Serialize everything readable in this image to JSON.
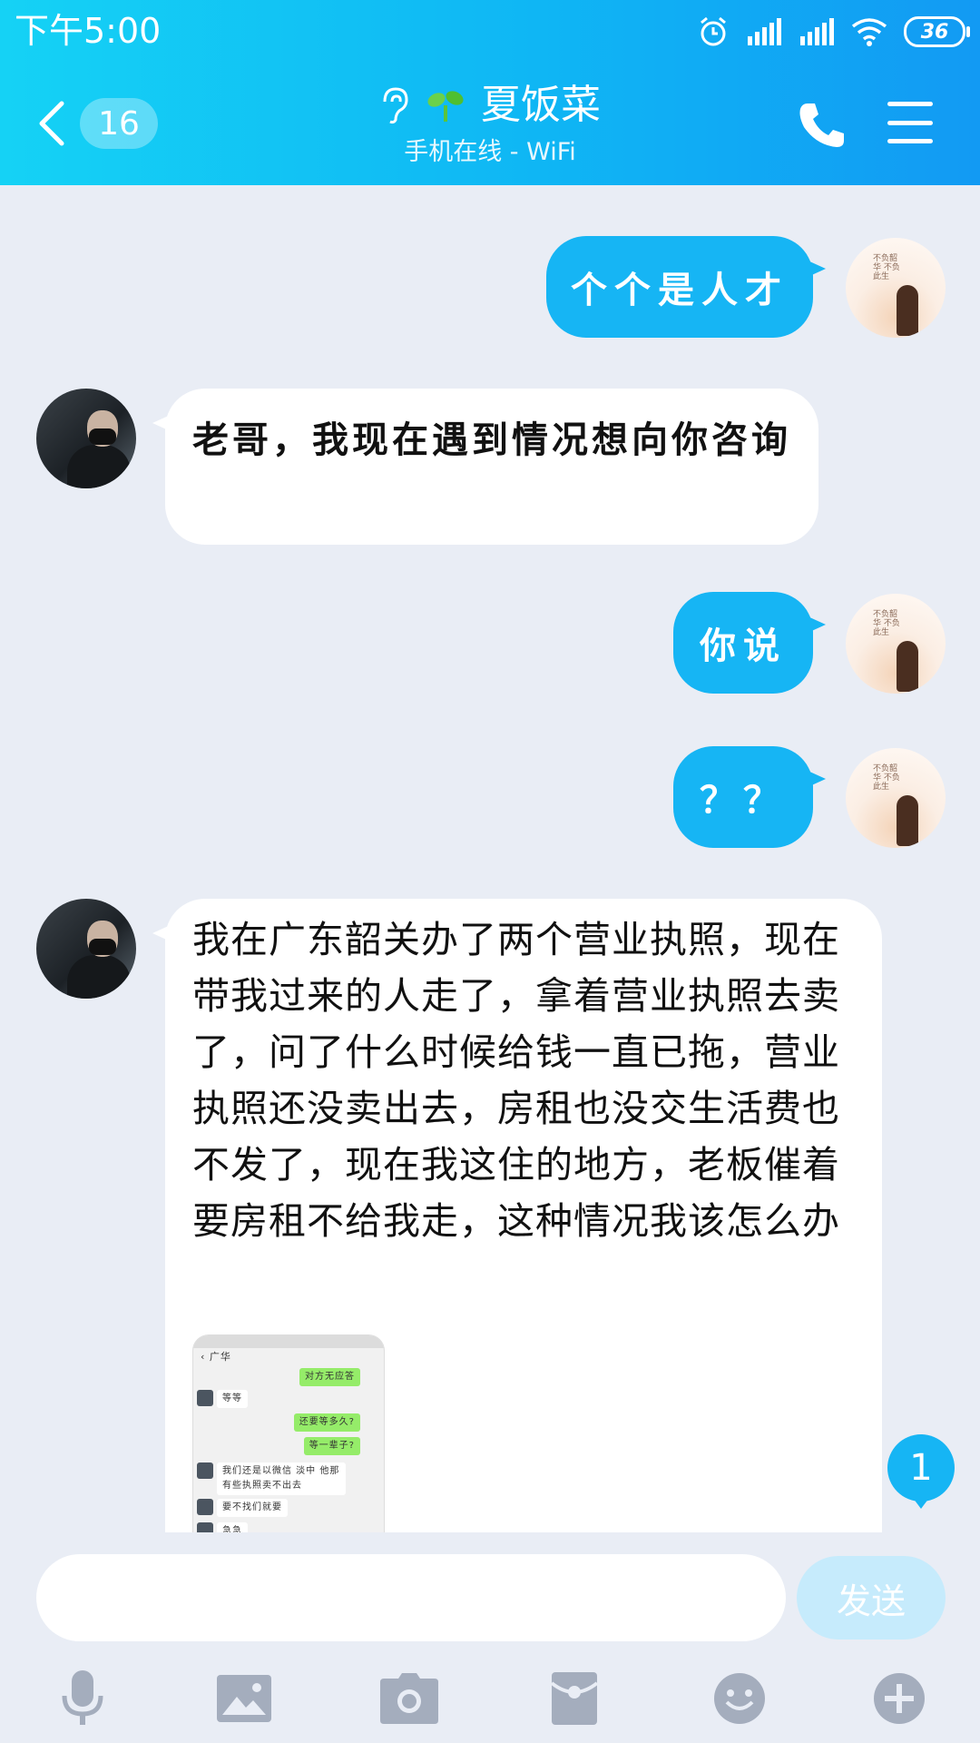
{
  "status_bar": {
    "time": "下午5:00",
    "battery": "36"
  },
  "header": {
    "back_count": "16",
    "contact_name": "夏饭菜",
    "presence": "手机在线 - WiFi"
  },
  "messages": [
    {
      "from": "me",
      "text": "个个是人才"
    },
    {
      "from": "other",
      "text": "老哥，我现在遇到情况想向你咨询"
    },
    {
      "from": "me",
      "text": "你说"
    },
    {
      "from": "me",
      "text": "？？"
    },
    {
      "from": "other",
      "text": "我在广东韶关办了两个营业执照，现在带我过来的人走了，拿着营业执照去卖了，问了什么时候给钱一直已拖，营业执照还没卖出去，房租也没交生活费也不发了，现在我这住的地方，老板催着要房租不给我走，这种情况我该怎么办"
    }
  ],
  "thumbnail": {
    "title": "广华",
    "items": [
      "对方无应答",
      "等等",
      "还要等多久?",
      "等一辈子?",
      "我们还是以微信 淡中 他那有些执照卖不出去",
      "要不找们就要",
      "急急"
    ]
  },
  "unread_badge": "1",
  "input": {
    "placeholder": "",
    "send_label": "发送"
  },
  "toolbar": [
    "mic-icon",
    "image-icon",
    "camera-icon",
    "red-packet-icon",
    "emoji-icon",
    "plus-icon"
  ],
  "colors": {
    "accent": "#16b5f4",
    "background": "#e9edf5"
  }
}
